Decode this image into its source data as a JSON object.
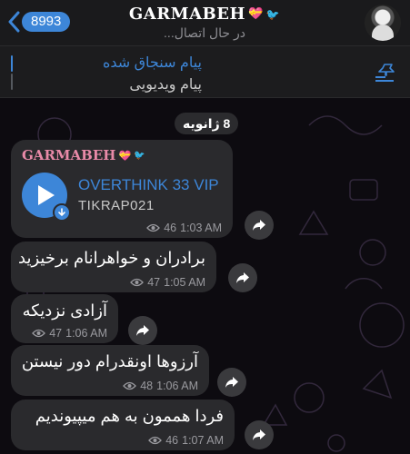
{
  "header": {
    "back_count": "8993",
    "title": "GARMABEH",
    "title_deco": "💝",
    "title_bird": "🐦",
    "status": "در حال اتصال..."
  },
  "pinned": {
    "title": "پیام سنجاق شده",
    "subtitle": "پیام ویدیویی"
  },
  "date_label": "8 ژانویه",
  "audio_message": {
    "sender": "GARMABEH",
    "sender_deco": "💝",
    "sender_bird": "🐦",
    "track_title": "OVERTHINK 33 VIP",
    "artist": "TIKRAP021",
    "views": "46",
    "time": "1:03 AM"
  },
  "messages": [
    {
      "text": "برادران و خواهرانام برخیزید",
      "views": "47",
      "time": "1:05 AM"
    },
    {
      "text": "آزادی نزدیکه",
      "views": "47",
      "time": "1:06 AM"
    },
    {
      "text": "آرزوها اونقدرام دور نیستن",
      "views": "48",
      "time": "1:06 AM"
    },
    {
      "text": "فردا هممون به هم میپیوندیم",
      "views": "46",
      "time": "1:07 AM"
    }
  ],
  "colors": {
    "accent": "#3d86d8",
    "bubble": "#2a2a2d",
    "sender_name": "#e98aa8"
  },
  "icons": {
    "back": "chevron-left-icon",
    "pinned_list": "pinned-list-icon",
    "views": "eye-icon",
    "share": "share-arrow-icon",
    "play": "play-icon",
    "download": "download-arrow-icon"
  }
}
